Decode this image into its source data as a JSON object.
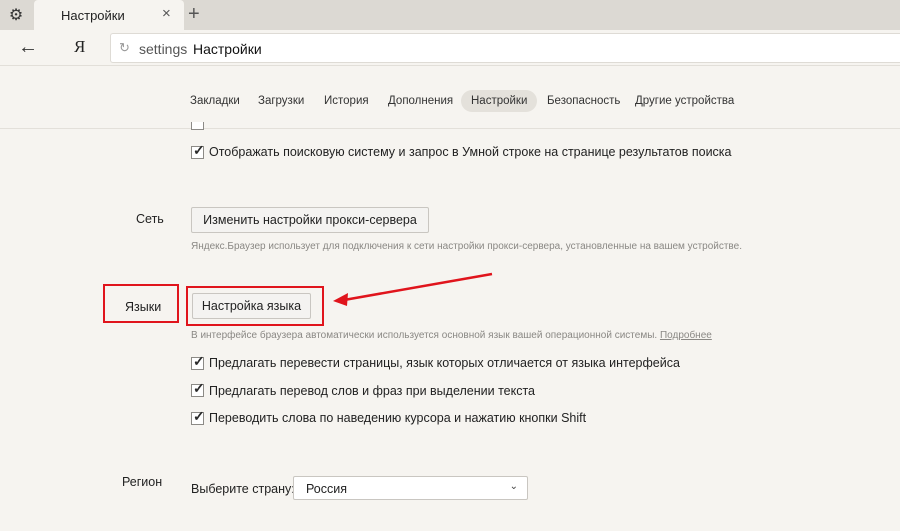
{
  "tab": {
    "title": "Настройки",
    "close": "×",
    "new_tab": "+"
  },
  "toolbar": {
    "back": "←",
    "logo": "Я",
    "url_prefix": "settings",
    "url_title": "Настройки"
  },
  "nav": [
    "Закладки",
    "Загрузки",
    "История",
    "Дополнения",
    "Настройки",
    "Безопасность",
    "Другие устройства"
  ],
  "search": {
    "show_search_label": "Отображать поисковую систему и запрос в Умной строке на странице результатов поиска"
  },
  "network": {
    "label": "Сеть",
    "button": "Изменить настройки прокси-сервера",
    "hint": "Яндекс.Браузер использует для подключения к сети настройки прокси-сервера, установленные на вашем устройстве."
  },
  "languages": {
    "label": "Языки",
    "button": "Настройка языка",
    "hint": "В интерфейсе браузера автоматически используется основной язык вашей операционной системы.",
    "hint_link": "Подробнее",
    "options": [
      "Предлагать перевести страницы, язык которых отличается от языка интерфейса",
      "Предлагать перевод слов и фраз при выделении текста",
      "Переводить слова по наведению курсора и нажатию кнопки Shift"
    ]
  },
  "region": {
    "label": "Регион",
    "select_label": "Выберите страну:",
    "selected": "Россия"
  },
  "colors": {
    "annotation": "#e0141c",
    "background": "#f6f4f0"
  }
}
